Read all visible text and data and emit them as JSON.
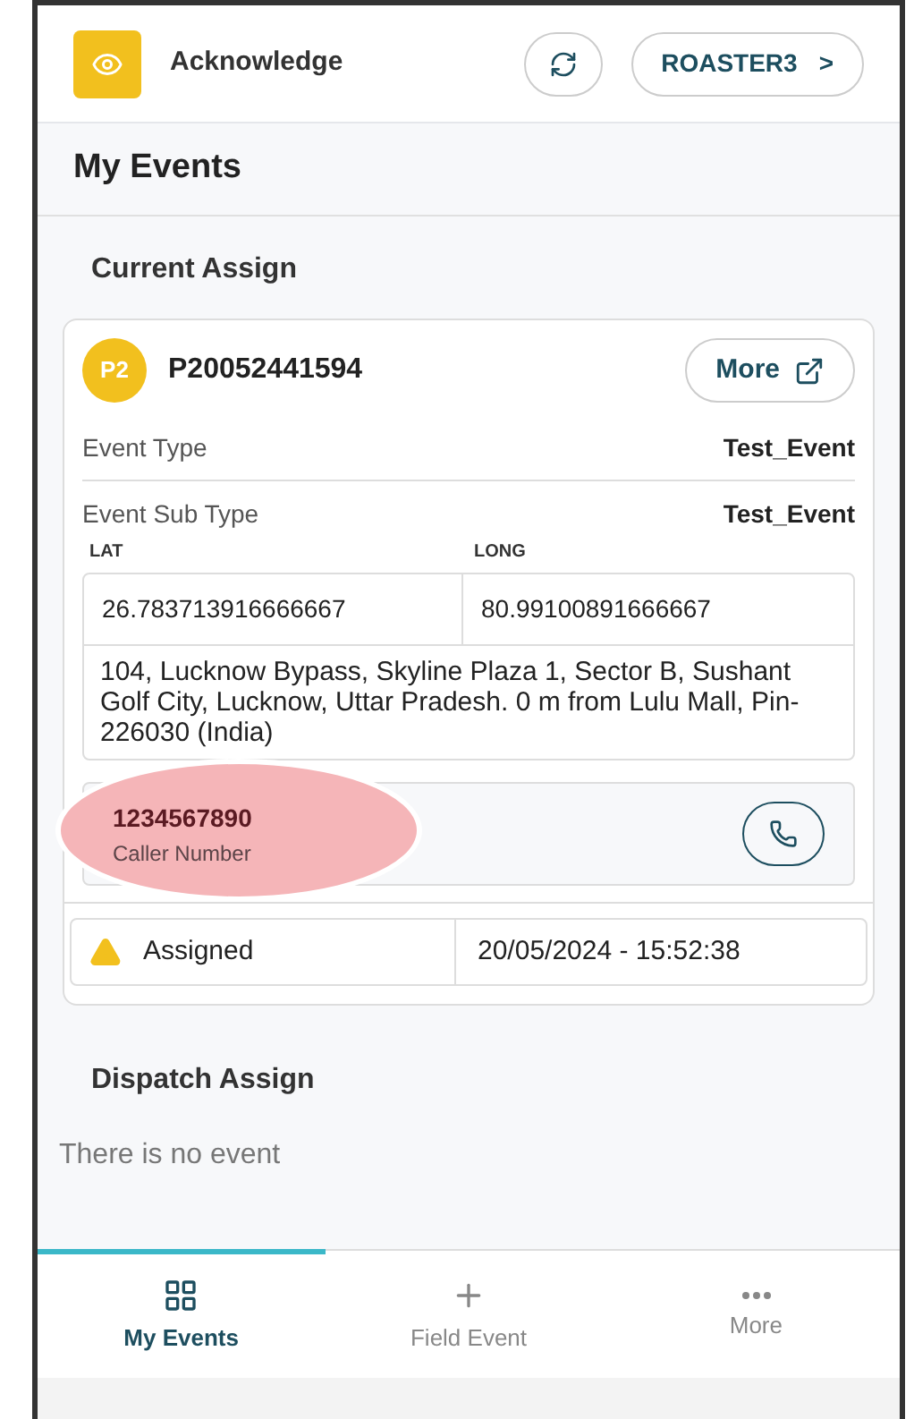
{
  "header": {
    "acknowledge": "Acknowledge",
    "roster": "ROASTER3",
    "roster_arrow": ">"
  },
  "title": "My Events",
  "current": {
    "heading": "Current Assign",
    "priority": "P2",
    "event_id": "P20052441594",
    "more": "More",
    "fields": [
      {
        "label": "Event Type",
        "value": "Test_Event"
      },
      {
        "label": "Event Sub Type",
        "value": "Test_Event"
      }
    ],
    "lat_label": "LAT",
    "long_label": "LONG",
    "lat": "26.783713916666667",
    "long": "80.99100891666667",
    "address": "104, Lucknow Bypass, Skyline Plaza 1, Sector B, Sushant Golf City, Lucknow, Uttar Pradesh. 0 m from Lulu Mall, Pin-226030 (India)",
    "caller_number": "1234567890",
    "caller_label": "Caller Number",
    "highlighted": true,
    "status": "Assigned",
    "timestamp": "20/05/2024 - 15:52:38"
  },
  "dispatch": {
    "heading": "Dispatch Assign",
    "empty": "There is no event"
  },
  "nav": [
    {
      "kind": "grid",
      "label": "My Events",
      "selected": true
    },
    {
      "kind": "plus",
      "label": "Field Event",
      "selected": false
    },
    {
      "kind": "dots",
      "label": "More",
      "selected": false
    }
  ]
}
